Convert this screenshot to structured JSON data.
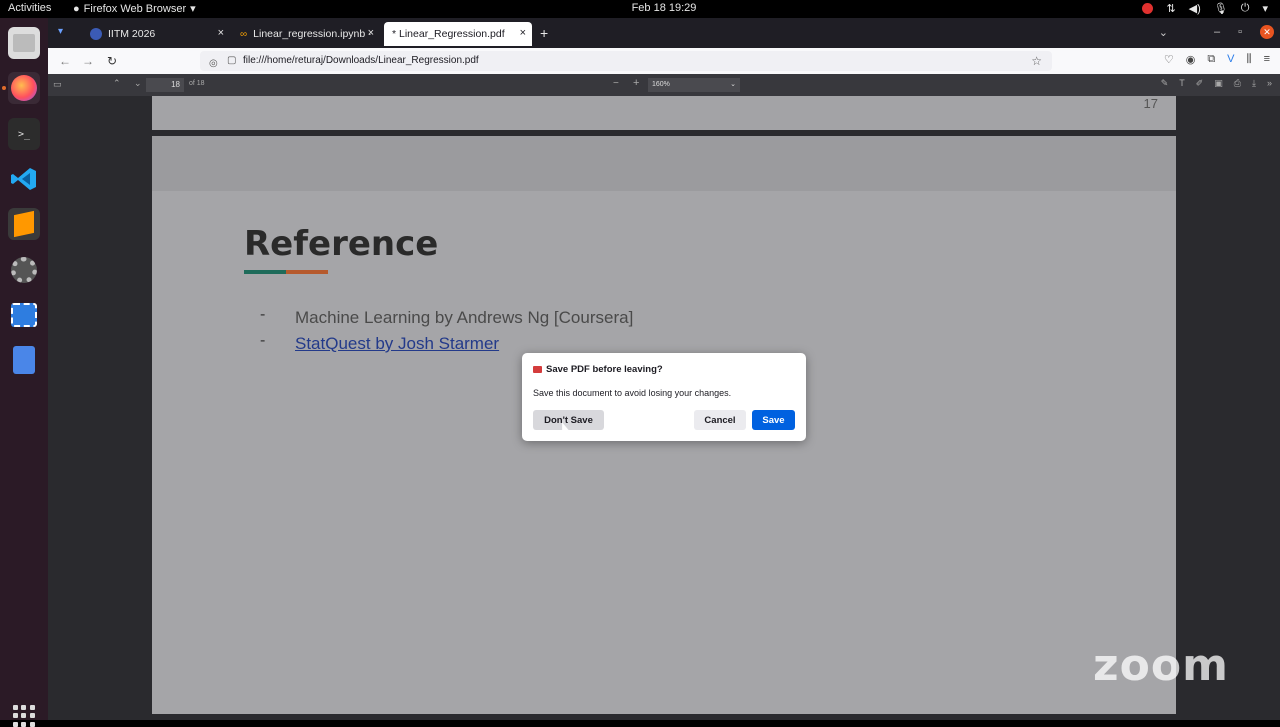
{
  "system": {
    "activities": "Activities",
    "app_menu": "Firefox Web Browser",
    "clock": "Feb 18  19:29"
  },
  "tabs": [
    {
      "label": "IITM 2026",
      "close": "×"
    },
    {
      "label": "Linear_regression.ipynb ·",
      "close": "×"
    },
    {
      "label": "* Linear_Regression.pdf",
      "close": "×"
    }
  ],
  "new_tab": "+",
  "address": {
    "url": "file:///home/returaj/Downloads/Linear_Regression.pdf"
  },
  "pdf_toolbar": {
    "page_number": "18",
    "page_of": "of 18",
    "zoom": "160%"
  },
  "document": {
    "prev_page_number": "17",
    "title": "Reference",
    "bullets": [
      {
        "marker": "-",
        "text": "Machine Learning by Andrews Ng [Coursera]"
      },
      {
        "marker": "-",
        "text": "StatQuest by Josh Starmer"
      }
    ]
  },
  "dialog": {
    "title": "Save PDF before leaving?",
    "message": "Save this document to avoid losing your changes.",
    "dont_save": "Don't Save",
    "cancel": "Cancel",
    "save": "Save"
  },
  "overlay": {
    "zoom_logo": "zoom"
  },
  "colors": {
    "dock_bg": "#2b1a26",
    "save_blue": "#0061e0",
    "ubuntu_orange": "#e95420"
  }
}
